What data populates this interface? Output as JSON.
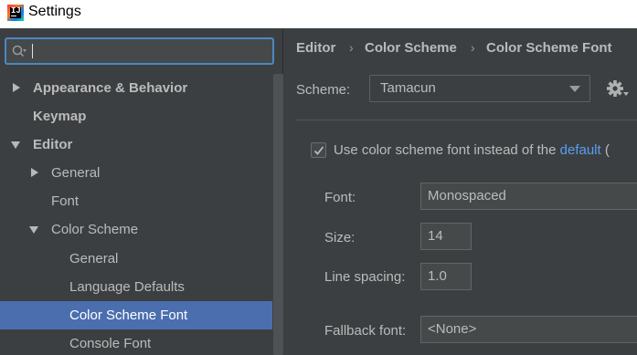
{
  "window": {
    "title": "Settings"
  },
  "search": {
    "value": "",
    "placeholder": ""
  },
  "sidebar": {
    "items": [
      {
        "label": "Appearance & Behavior"
      },
      {
        "label": "Keymap"
      },
      {
        "label": "Editor"
      },
      {
        "label": "General"
      },
      {
        "label": "Font"
      },
      {
        "label": "Color Scheme"
      },
      {
        "label": "General"
      },
      {
        "label": "Language Defaults"
      },
      {
        "label": "Color Scheme Font"
      },
      {
        "label": "Console Font"
      }
    ]
  },
  "breadcrumb": {
    "items": [
      "Editor",
      "Color Scheme",
      "Color Scheme Font"
    ],
    "separator": "›"
  },
  "scheme": {
    "label": "Scheme:",
    "value": "Tamacun"
  },
  "checkbox": {
    "checked": true,
    "text": "Use color scheme font instead of the ",
    "link": "default",
    "suffix": " ("
  },
  "fields": {
    "font": {
      "label": "Font:",
      "value": "Monospaced"
    },
    "size": {
      "label": "Size:",
      "value": "14"
    },
    "line_spacing": {
      "label": "Line spacing:",
      "value": "1.0"
    },
    "fallback_font": {
      "label": "Fallback font:",
      "value": "<None>"
    }
  },
  "colors": {
    "selection": "#4b6eaf",
    "link": "#589df6",
    "focus_border": "#4c88c2"
  },
  "icons": {
    "app": "intellij-icon",
    "search": "search-icon",
    "settings": "gear-icon"
  }
}
